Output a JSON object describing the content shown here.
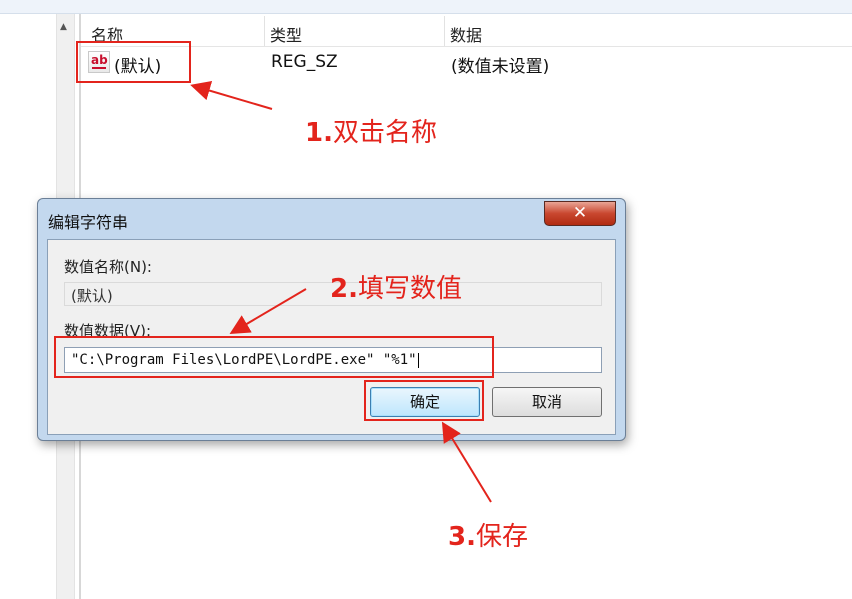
{
  "list": {
    "columns": [
      "名称",
      "类型",
      "数据"
    ],
    "row": {
      "name": "(默认)",
      "type": "REG_SZ",
      "data": "(数值未设置)",
      "icon": "ab-string-icon"
    }
  },
  "dialog": {
    "title": "编辑字符串",
    "close_glyph": "✕",
    "name_label": "数值名称(N):",
    "name_value": "(默认)",
    "data_label": "数值数据(V):",
    "data_value": "\"C:\\Program Files\\LordPE\\LordPE.exe\" \"%1\"",
    "ok_label": "确定",
    "cancel_label": "取消"
  },
  "annotations": {
    "step1_num": "1.",
    "step1_text": "双击名称",
    "step2_num": "2.",
    "step2_text": "填写数值",
    "step3_num": "3.",
    "step3_text": "保存",
    "color": "#e3241c"
  }
}
